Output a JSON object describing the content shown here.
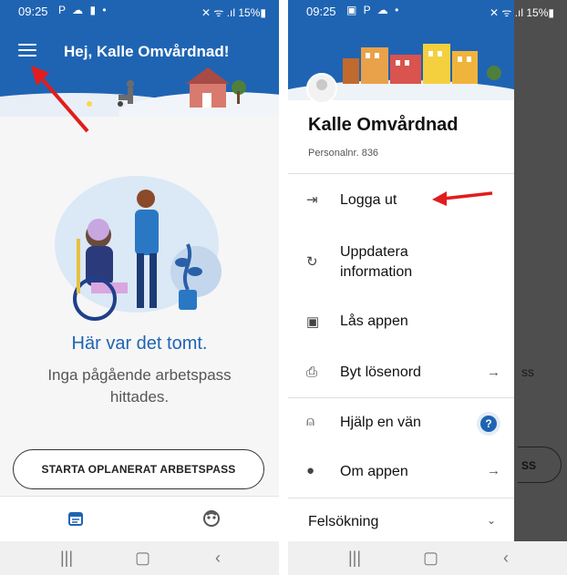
{
  "left": {
    "status": {
      "time": "09:25",
      "left_icons": "P ☁ ▮ •",
      "right_icons": "✕ ᯤ .ıl 15%▮"
    },
    "header": {
      "title": "Hej, Kalle Omvårdnad!"
    },
    "empty": {
      "title": "Här var det tomt.",
      "subtitle": "Inga pågående arbetspass hittades."
    },
    "start_button": "STARTA OPLANERAT ARBETSPASS",
    "nav_icons": [
      "calendar-icon",
      "avatar-icon"
    ]
  },
  "right": {
    "status": {
      "time": "09:25",
      "left_icons": "▣ P ☁ •",
      "right_icons": "✕ ᯤ .ıl 15%▮"
    },
    "user": {
      "name": "Kalle Omvårdnad",
      "number": "Personalnr. 836"
    },
    "menu": [
      {
        "label": "Logga ut",
        "icon": "logout-icon"
      },
      {
        "label": "Uppdatera information",
        "icon": "refresh-icon"
      },
      {
        "label": "Lås appen",
        "icon": "lock-icon"
      },
      {
        "label": "Byt lösenord",
        "icon": "password-icon"
      },
      {
        "label": "Hjälp en vän",
        "icon": "wifi-share-icon"
      },
      {
        "label": "Om appen",
        "icon": "info-icon"
      },
      {
        "label": "Felsökning",
        "icon": "chevron-down-icon"
      }
    ],
    "behind": {
      "text1": "ss",
      "text2": "SS"
    }
  },
  "colors": {
    "brand": "#1f64b3",
    "arrow": "#e11d1d"
  }
}
